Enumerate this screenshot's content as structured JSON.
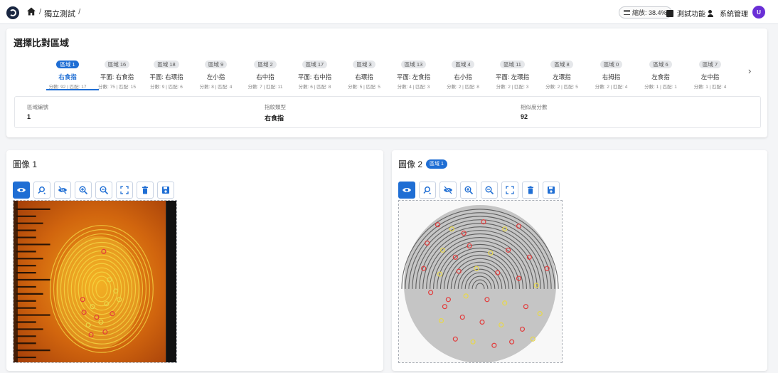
{
  "breadcrumb": {
    "current": "獨立測試",
    "sep1": "/",
    "sep2": "/"
  },
  "topbar": {
    "zoom_label": "縮放: 38.4%",
    "test_label": "測試功能",
    "system_label": "系統管理",
    "avatar_initial": "U"
  },
  "region": {
    "title": "選擇比對區域",
    "tabs": [
      {
        "badge": "區域 1",
        "name": "右食指",
        "score": "分數: 92 | 匹配: 17",
        "active": true
      },
      {
        "badge": "區域 16",
        "name": "平面: 右食指",
        "score": "分數: 75 | 匹配: 15"
      },
      {
        "badge": "區域 18",
        "name": "平面: 右環指",
        "score": "分數: 9 | 匹配: 6"
      },
      {
        "badge": "區域 9",
        "name": "左小指",
        "score": "分數: 8 | 匹配: 4"
      },
      {
        "badge": "區域 2",
        "name": "右中指",
        "score": "分數: 7 | 匹配: 11"
      },
      {
        "badge": "區域 17",
        "name": "平面: 右中指",
        "score": "分數: 6 | 匹配: 8"
      },
      {
        "badge": "區域 3",
        "name": "右環指",
        "score": "分數: 5 | 匹配: 5"
      },
      {
        "badge": "區域 13",
        "name": "平面: 左食指",
        "score": "分數: 4 | 匹配: 3"
      },
      {
        "badge": "區域 4",
        "name": "右小指",
        "score": "分數: 2 | 匹配: 8"
      },
      {
        "badge": "區域 11",
        "name": "平面: 左環指",
        "score": "分數: 2 | 匹配: 3"
      },
      {
        "badge": "區域 8",
        "name": "左環指",
        "score": "分數: 2 | 匹配: 5"
      },
      {
        "badge": "區域 0",
        "name": "右拇指",
        "score": "分數: 2 | 匹配: 4"
      },
      {
        "badge": "區域 6",
        "name": "左食指",
        "score": "分數: 1 | 匹配: 1"
      },
      {
        "badge": "區域 7",
        "name": "左中指",
        "score": "分數: 1 | 匹配: 4"
      }
    ],
    "info": {
      "id_label": "區域編號",
      "id_value": "1",
      "type_label": "指紋類型",
      "type_value": "右食指",
      "score_label": "相似度分數",
      "score_value": "92"
    }
  },
  "image1": {
    "title": "圖像 1"
  },
  "image2": {
    "title": "圖像 2",
    "badge": "區域 1"
  },
  "toolbar_icons": [
    "eye-icon",
    "magnify-reset-icon",
    "eye-off-icon",
    "zoom-in-icon",
    "zoom-out-icon",
    "fit-screen-icon",
    "trash-icon",
    "save-icon"
  ],
  "colors": {
    "accent": "#1f6ed4",
    "avatar": "#6a2fd6",
    "marker_red": "#e23b3b",
    "marker_yellow": "#e8d84a"
  }
}
